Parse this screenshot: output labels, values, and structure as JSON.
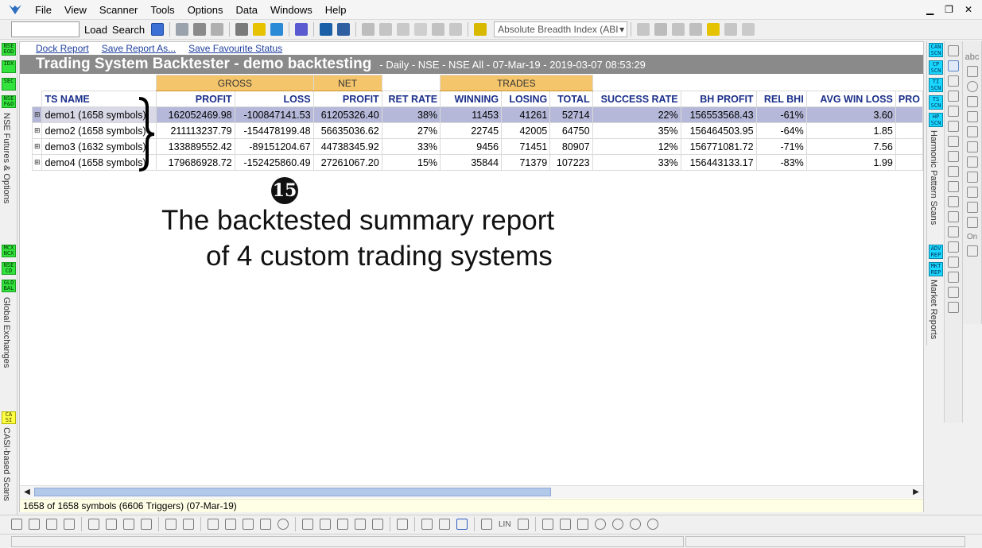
{
  "menu": [
    "File",
    "View",
    "Scanner",
    "Tools",
    "Options",
    "Data",
    "Windows",
    "Help"
  ],
  "toolbar": {
    "load_label": "Load",
    "search_label": "Search",
    "indicator_dropdown": "Absolute Breadth Index (ABI"
  },
  "left_strip": {
    "nse_badges": [
      "NSE EOD",
      "IDX",
      "SEC",
      "NSE F&O"
    ],
    "nse_label": "NSE Futures & Options",
    "global_badges": [
      "MCX NCX",
      "NSE CD",
      "GLO BAL"
    ],
    "global_label": "Global Exchanges",
    "casi_badge": "CA SI",
    "casi_label": "CASI-based Scans"
  },
  "right_strip": {
    "pattern_badges": [
      "CAN SCN",
      "CP SCN",
      "TI SCN",
      "TS SCN",
      "HP SCN"
    ],
    "pattern_label": "Harmonic Pattern Scans",
    "report_badges": [
      "ADV REP",
      "MKT REP"
    ],
    "report_label": "Market Reports"
  },
  "links": {
    "dock": "Dock Report",
    "save_as": "Save Report As...",
    "save_fav": "Save Favourite Status"
  },
  "report": {
    "title": "Trading System Backtester - demo backtesting",
    "subtitle": "- Daily - NSE - NSE All - 07-Mar-19 - 2019-03-07 08:53:29"
  },
  "groups": {
    "gross": "GROSS",
    "net": "NET",
    "trades": "TRADES"
  },
  "columns": [
    "TS NAME",
    "PROFIT",
    "LOSS",
    "PROFIT",
    "RET RATE",
    "WINNING",
    "LOSING",
    "TOTAL",
    "SUCCESS RATE",
    "BH PROFIT",
    "REL BHI",
    "AVG WIN LOSS",
    "PRO"
  ],
  "rows": [
    [
      "demo1 (1658 symbols)",
      "162052469.98",
      "-100847141.53",
      "61205326.40",
      "38%",
      "11453",
      "41261",
      "52714",
      "22%",
      "156553568.43",
      "-61%",
      "3.60",
      ""
    ],
    [
      "demo2 (1658 symbols)",
      "211113237.79",
      "-154478199.48",
      "56635036.62",
      "27%",
      "22745",
      "42005",
      "64750",
      "35%",
      "156464503.95",
      "-64%",
      "1.85",
      ""
    ],
    [
      "demo3 (1632 symbols)",
      "133889552.42",
      "-89151204.67",
      "44738345.92",
      "33%",
      "9456",
      "71451",
      "80907",
      "12%",
      "156771081.72",
      "-71%",
      "7.56",
      ""
    ],
    [
      "demo4 (1658 symbols)",
      "179686928.72",
      "-152425860.49",
      "27261067.20",
      "15%",
      "35844",
      "71379",
      "107223",
      "33%",
      "156443133.17",
      "-83%",
      "1.99",
      ""
    ]
  ],
  "annotation": {
    "number": "15",
    "line1": "The backtested summary report",
    "line2": "of 4 custom trading systems"
  },
  "status": "1658 of 1658 symbols (6606 Triggers) (07-Mar-19)",
  "drawing_tools": {
    "on_label": "On",
    "lin_label": "LIN"
  }
}
